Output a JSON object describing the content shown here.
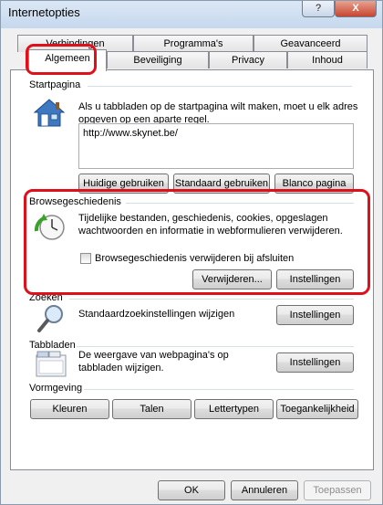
{
  "window": {
    "title": "Internetopties",
    "help_label": "?",
    "close_label": "X"
  },
  "tabs": {
    "row_back": [
      "Verbindingen",
      "Programma's",
      "Geavanceerd"
    ],
    "row_front": [
      "Algemeen",
      "Beveiliging",
      "Privacy",
      "Inhoud"
    ],
    "selected": "Algemeen"
  },
  "startpagina": {
    "label": "Startpagina",
    "description": "Als u tabbladen op de startpagina wilt maken, moet u elk adres opgeven op een aparte regel.",
    "url_value": "http://www.skynet.be/",
    "buttons": [
      "Huidige gebruiken",
      "Standaard gebruiken",
      "Blanco pagina"
    ]
  },
  "browsegeschiedenis": {
    "label": "Browsegeschiedenis",
    "description": "Tijdelijke bestanden, geschiedenis, cookies, opgeslagen wachtwoorden en informatie in webformulieren verwijderen.",
    "checkbox_label": "Browsegeschiedenis verwijderen bij afsluiten",
    "delete_label": "Verwijderen...",
    "settings_label": "Instellingen"
  },
  "zoeken": {
    "label": "Zoeken",
    "description": "Standaardzoekinstellingen wijzigen",
    "settings_label": "Instellingen"
  },
  "tabbladen": {
    "label": "Tabbladen",
    "description": "De weergave van webpagina's op tabbladen wijzigen.",
    "settings_label": "Instellingen"
  },
  "vormgeving": {
    "label": "Vormgeving",
    "buttons": [
      "Kleuren",
      "Talen",
      "Lettertypen",
      "Toegankelijkheid"
    ]
  },
  "footer": {
    "ok_label": "OK",
    "cancel_label": "Annuleren",
    "apply_label": "Toepassen"
  },
  "colors": {
    "highlight": "#e0101a",
    "titlebar": "#c6d8ee"
  }
}
